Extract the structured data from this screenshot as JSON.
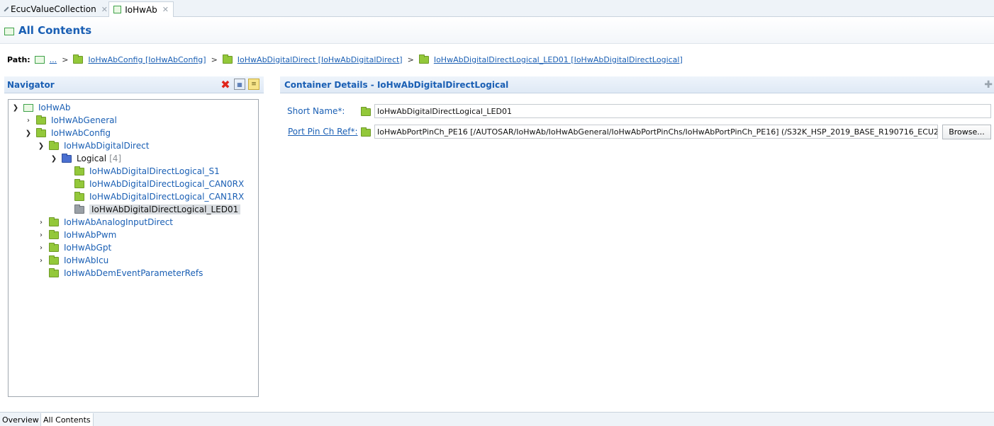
{
  "editor_tabs": [
    {
      "label": "EcucValueCollection"
    },
    {
      "label": "IoHwAb"
    }
  ],
  "page": {
    "title": "All Contents"
  },
  "path": {
    "label": "Path:",
    "ellipsis": "...",
    "crumbs": [
      "IoHwAbConfig [IoHwAbConfig]",
      "IoHwAbDigitalDirect [IoHwAbDigitalDirect]",
      "IoHwAbDigitalDirectLogical_LED01 [IoHwAbDigitalDirectLogical]"
    ],
    "separator": ">"
  },
  "navigator": {
    "title": "Navigator",
    "tree": [
      {
        "label": "IoHwAb"
      },
      {
        "label": "IoHwAbGeneral"
      },
      {
        "label": "IoHwAbConfig"
      },
      {
        "label": "IoHwAbDigitalDirect"
      },
      {
        "label": "Logical",
        "count": "[4]"
      },
      {
        "label": "IoHwAbDigitalDirectLogical_S1"
      },
      {
        "label": "IoHwAbDigitalDirectLogical_CAN0RX"
      },
      {
        "label": "IoHwAbDigitalDirectLogical_CAN1RX"
      },
      {
        "label": "IoHwAbDigitalDirectLogical_LED01"
      },
      {
        "label": "IoHwAbAnalogInputDirect"
      },
      {
        "label": "IoHwAbPwm"
      },
      {
        "label": "IoHwAbGpt"
      },
      {
        "label": "IoHwAbIcu"
      },
      {
        "label": "IoHwAbDemEventParameterRefs"
      }
    ]
  },
  "details": {
    "title": "Container Details - IoHwAbDigitalDirectLogical",
    "short_name_label": "Short Name*:",
    "short_name_value": "IoHwAbDigitalDirectLogical_LED01",
    "port_pin_label": "Port Pin Ch Ref*:",
    "port_pin_value": "IoHwAbPortPinCh_PE16 [/AUTOSAR/IoHwAb/IoHwAbGeneral/IoHwAbPortPinChs/IoHwAbPortPinCh_PE16] (/S32K_HSP_2019_BASE_R190716_ECU2",
    "browse_label": "Browse..."
  },
  "bottom_tabs": [
    {
      "label": "Overview"
    },
    {
      "label": "All Contents"
    }
  ],
  "colors": {
    "accent": "#1a5fb4",
    "folder": "#93c83a",
    "folder_blue": "#4a6fd0",
    "delete": "#e0261b"
  },
  "icons": {
    "editor_tab_1": "diamond-icon",
    "editor_tab_2": "outline-folder-icon",
    "close": "close-icon",
    "delete": "red-x-icon",
    "expand_all": "expand-all-icon",
    "link": "link-with-editor-icon",
    "add": "plus-icon"
  }
}
